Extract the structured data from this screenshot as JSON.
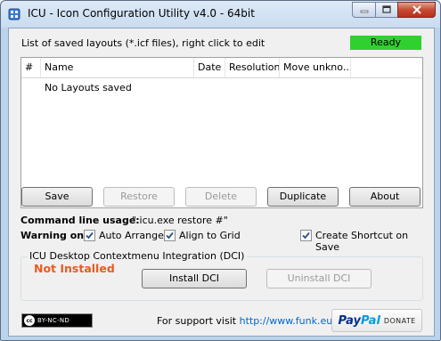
{
  "window": {
    "title": "ICU - Icon Configuration Utility v4.0 - 64bit"
  },
  "list": {
    "caption": "List of saved layouts (*.icf files), right click to edit",
    "status": "Ready",
    "status_color": "#2fd12f",
    "columns": [
      "#",
      "Name",
      "Date",
      "Resolution",
      "Move unkno..."
    ],
    "empty_text": "No Layouts saved"
  },
  "buttons": {
    "save": "Save",
    "restore": "Restore",
    "delete": "Delete",
    "duplicate": "Duplicate",
    "about": "About"
  },
  "command_line": {
    "label": "Command line usage:",
    "value": "\" icu.exe restore #\""
  },
  "warning": {
    "label": "Warning on:",
    "options": [
      {
        "label": "Auto Arrange",
        "checked": true
      },
      {
        "label": "Align to Grid",
        "checked": true
      },
      {
        "label": "Create Shortcut on Save",
        "checked": true
      }
    ]
  },
  "dci": {
    "group_title": "ICU Desktop Contextmenu Integration (DCI)",
    "status": "Not Installed",
    "status_color": "#e85a20",
    "install": "Install DCI",
    "uninstall": "Uninstall DCI"
  },
  "footer": {
    "license_badge": "BY-NC-ND",
    "support_prefix": "For support visit",
    "support_link": "http://www.funk.eu",
    "paypal_pay": "Pay",
    "paypal_pal": "Pal",
    "paypal_donate": "DONATE"
  }
}
